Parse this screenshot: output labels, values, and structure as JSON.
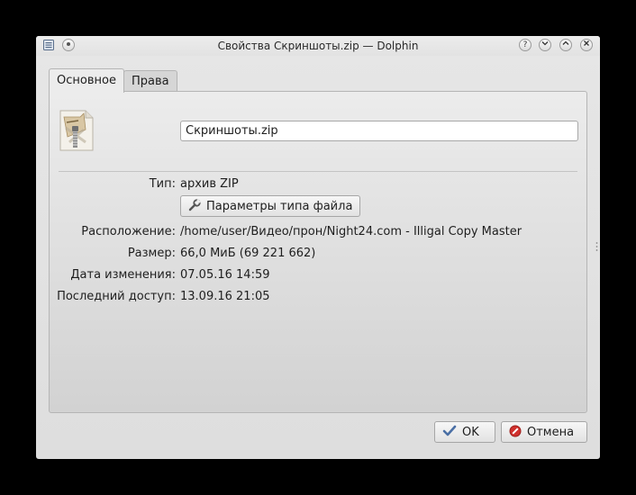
{
  "window": {
    "title": "Свойства Скриншоты.zip — Dolphin",
    "controls": [
      "?",
      "⌄",
      "⌃",
      "×"
    ]
  },
  "tabs": [
    {
      "label": "Основное",
      "active": true
    },
    {
      "label": "Права",
      "active": false
    }
  ],
  "general": {
    "file_name": "Скриншоты.zip",
    "file_icon": "zip-archive-icon",
    "type_label": "Тип:",
    "type_value": "архив ZIP",
    "file_type_button": "Параметры типа файла",
    "location_label": "Расположение:",
    "location_value": "/home/user/Видео/прон/Night24.com - Illigal Copy Master",
    "size_label": "Размер:",
    "size_value": "66,0 МиБ (69 221 662)",
    "modified_label": "Дата изменения:",
    "modified_value": "07.05.16 14:59",
    "accessed_label": "Последний доступ:",
    "accessed_value": "13.09.16 21:05"
  },
  "buttons": {
    "ok": "OK",
    "cancel": "Отмена"
  },
  "colors": {
    "ok_check": "#4a6fa5",
    "cancel_icon": "#d0312d"
  }
}
